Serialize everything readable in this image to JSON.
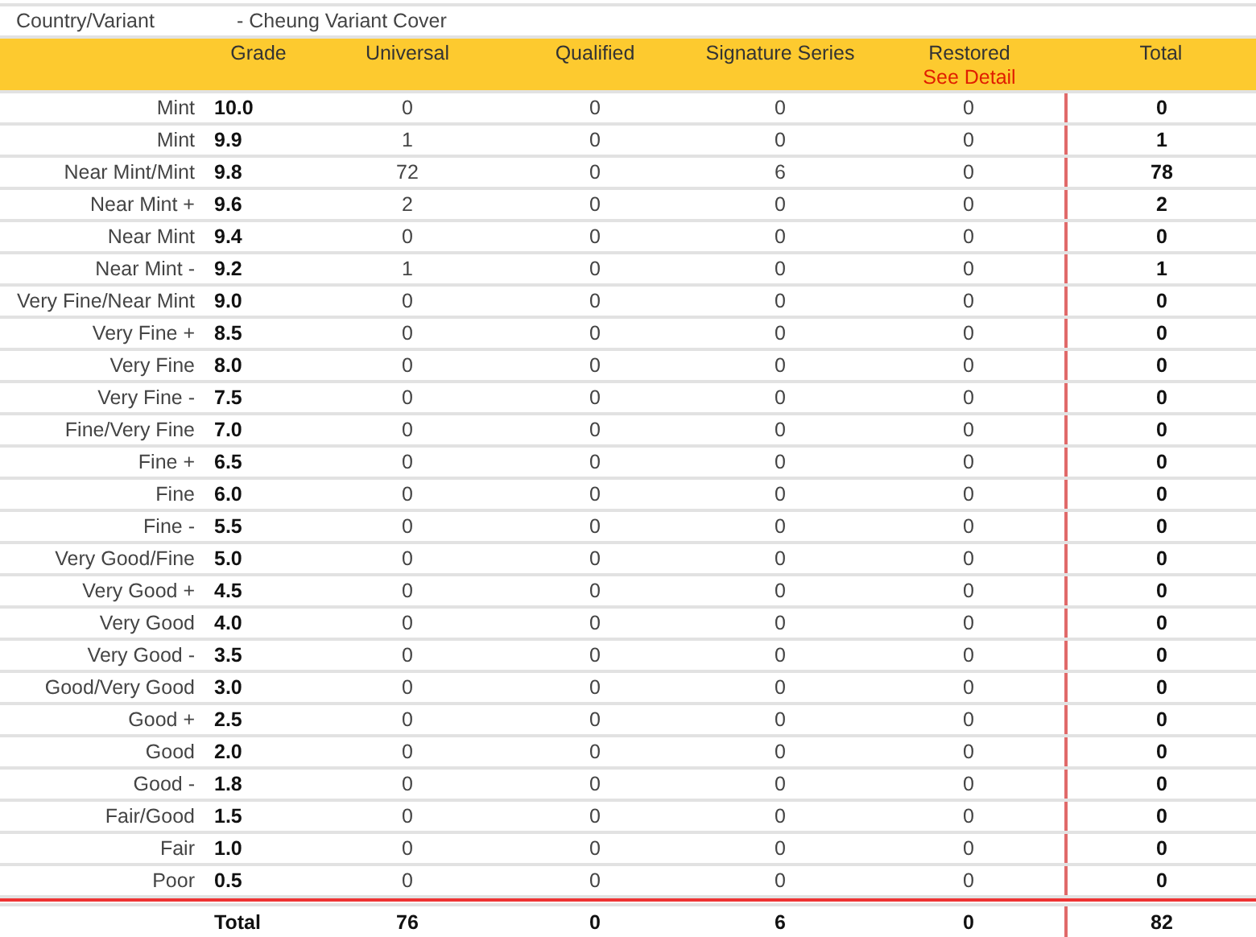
{
  "country_variant": {
    "label": "Country/Variant",
    "value": "- Cheung Variant Cover"
  },
  "columns": [
    {},
    {
      "label": "Grade"
    },
    {
      "label": "Universal"
    },
    {
      "label": "Qualified"
    },
    {
      "label": "Signature Series"
    },
    {
      "label": "Restored",
      "link": "See Detail"
    },
    {
      "label": "Total"
    }
  ],
  "rows": [
    [
      "Mint",
      "10.0",
      "0",
      "0",
      "0",
      "0",
      "0"
    ],
    [
      "Mint",
      "9.9",
      "1",
      "0",
      "0",
      "0",
      "1"
    ],
    [
      "Near Mint/Mint",
      "9.8",
      "72",
      "0",
      "6",
      "0",
      "78"
    ],
    [
      "Near Mint +",
      "9.6",
      "2",
      "0",
      "0",
      "0",
      "2"
    ],
    [
      "Near Mint",
      "9.4",
      "0",
      "0",
      "0",
      "0",
      "0"
    ],
    [
      "Near Mint -",
      "9.2",
      "1",
      "0",
      "0",
      "0",
      "1"
    ],
    [
      "Very Fine/Near Mint",
      "9.0",
      "0",
      "0",
      "0",
      "0",
      "0"
    ],
    [
      "Very Fine +",
      "8.5",
      "0",
      "0",
      "0",
      "0",
      "0"
    ],
    [
      "Very Fine",
      "8.0",
      "0",
      "0",
      "0",
      "0",
      "0"
    ],
    [
      "Very Fine -",
      "7.5",
      "0",
      "0",
      "0",
      "0",
      "0"
    ],
    [
      "Fine/Very Fine",
      "7.0",
      "0",
      "0",
      "0",
      "0",
      "0"
    ],
    [
      "Fine +",
      "6.5",
      "0",
      "0",
      "0",
      "0",
      "0"
    ],
    [
      "Fine",
      "6.0",
      "0",
      "0",
      "0",
      "0",
      "0"
    ],
    [
      "Fine -",
      "5.5",
      "0",
      "0",
      "0",
      "0",
      "0"
    ],
    [
      "Very Good/Fine",
      "5.0",
      "0",
      "0",
      "0",
      "0",
      "0"
    ],
    [
      "Very Good +",
      "4.5",
      "0",
      "0",
      "0",
      "0",
      "0"
    ],
    [
      "Very Good",
      "4.0",
      "0",
      "0",
      "0",
      "0",
      "0"
    ],
    [
      "Very Good -",
      "3.5",
      "0",
      "0",
      "0",
      "0",
      "0"
    ],
    [
      "Good/Very Good",
      "3.0",
      "0",
      "0",
      "0",
      "0",
      "0"
    ],
    [
      "Good +",
      "2.5",
      "0",
      "0",
      "0",
      "0",
      "0"
    ],
    [
      "Good",
      "2.0",
      "0",
      "0",
      "0",
      "0",
      "0"
    ],
    [
      "Good -",
      "1.8",
      "0",
      "0",
      "0",
      "0",
      "0"
    ],
    [
      "Fair/Good",
      "1.5",
      "0",
      "0",
      "0",
      "0",
      "0"
    ],
    [
      "Fair",
      "1.0",
      "0",
      "0",
      "0",
      "0",
      "0"
    ],
    [
      "Poor",
      "0.5",
      "0",
      "0",
      "0",
      "0",
      "0"
    ]
  ],
  "totals": {
    "label": "Total",
    "values": [
      "76",
      "0",
      "6",
      "0",
      "82"
    ]
  }
}
